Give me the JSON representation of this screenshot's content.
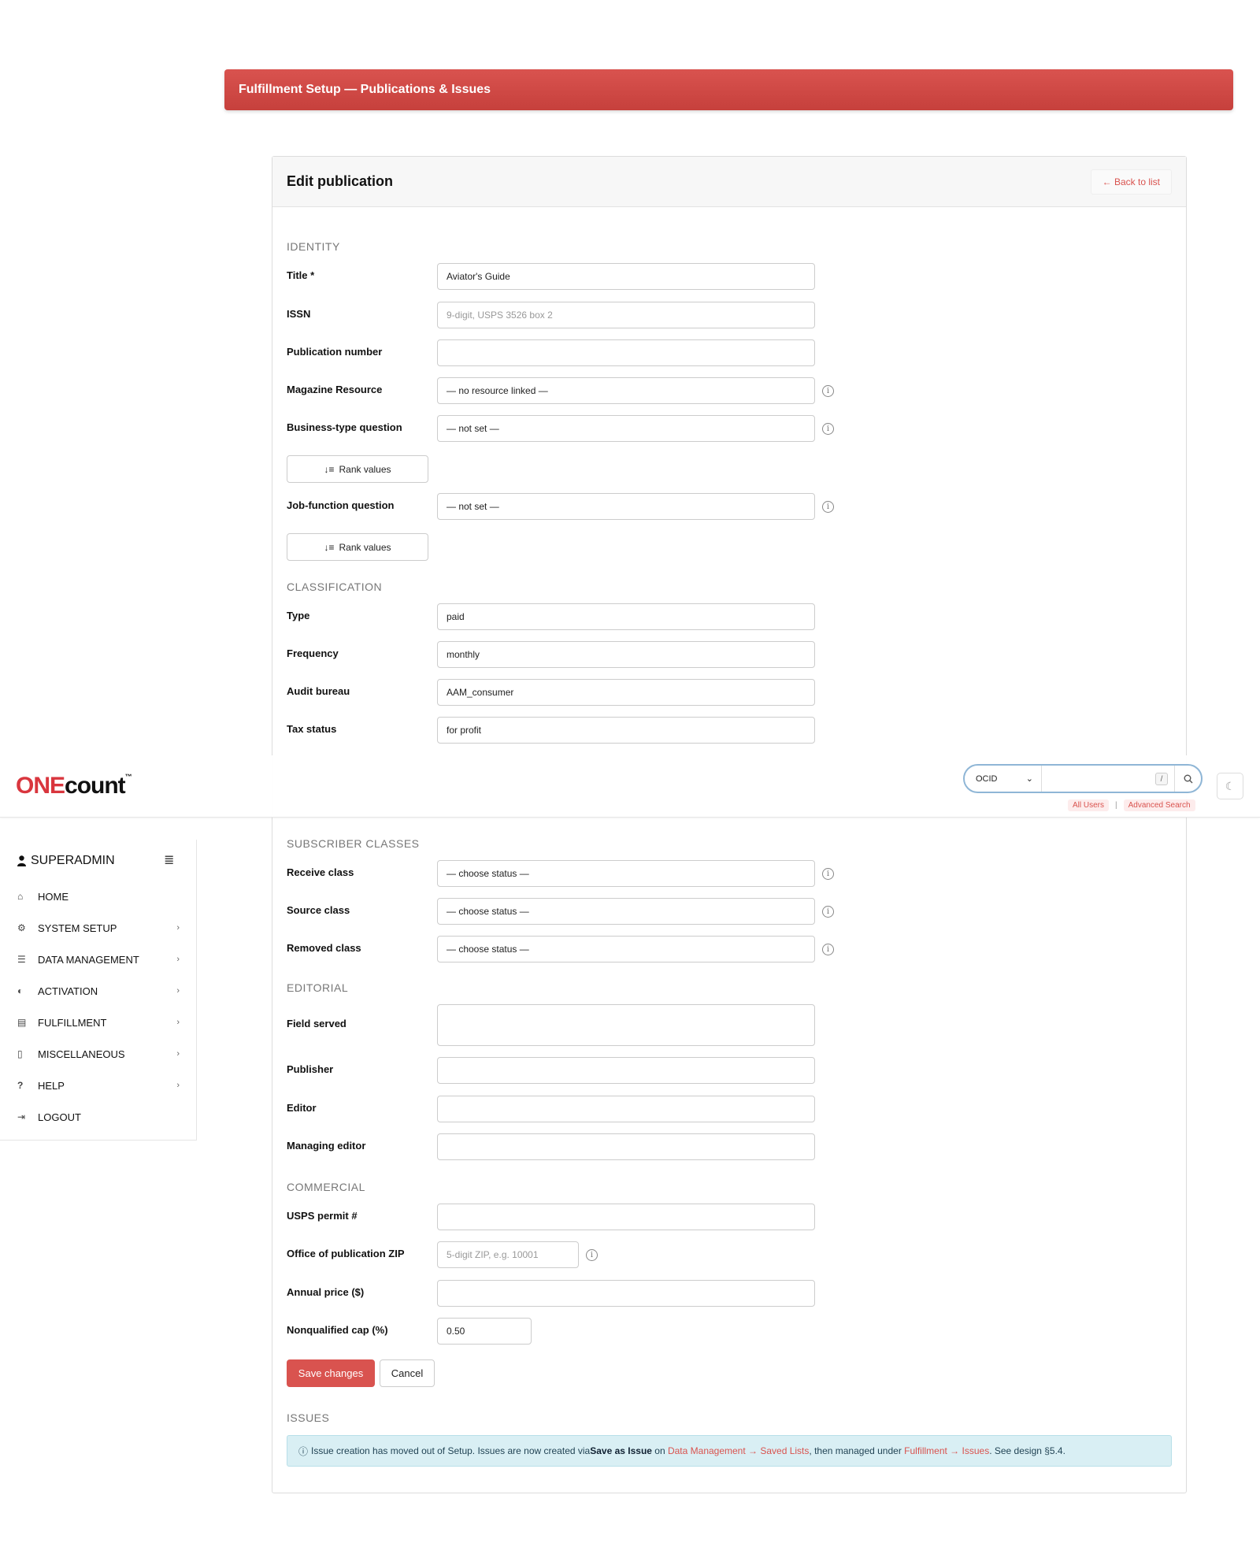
{
  "banner": {
    "title": "Fulfillment Setup — Publications & Issues"
  },
  "card": {
    "title": "Edit publication",
    "back_link": "← Back to list"
  },
  "sections": {
    "identity": "IDENTITY",
    "classification": "CLASSIFICATION",
    "subscriber_classes": "SUBSCRIBER CLASSES",
    "editorial": "EDITORIAL",
    "commercial": "COMMERCIAL",
    "issues": "ISSUES"
  },
  "identity": {
    "title_label": "Title *",
    "title_value": "Aviator's Guide",
    "issn_label": "ISSN",
    "issn_placeholder": "9-digit, USPS 3526 box 2",
    "pubnum_label": "Publication number",
    "pubnum_value": "",
    "magazine_label": "Magazine Resource",
    "magazine_value": "— no resource linked —",
    "business_label": "Business-type question",
    "business_value": "— not set —",
    "rank_label": "Rank values",
    "job_label": "Job-function question",
    "job_value": "— not set —"
  },
  "classification": {
    "type_label": "Type",
    "type_value": "paid",
    "frequency_label": "Frequency",
    "frequency_value": "monthly",
    "audit_label": "Audit bureau",
    "audit_value": "AAM_consumer",
    "tax_label": "Tax status",
    "tax_value": "for profit"
  },
  "subscriber_classes": {
    "receive_label": "Receive class",
    "receive_value": "— choose status —",
    "source_label": "Source class",
    "source_value": "— choose status —",
    "removed_label": "Removed class",
    "removed_value": "— choose status —"
  },
  "editorial": {
    "field_label": "Field served",
    "field_value": "",
    "publisher_label": "Publisher",
    "publisher_value": "",
    "editor_label": "Editor",
    "editor_value": "",
    "managing_label": "Managing editor",
    "managing_value": ""
  },
  "commercial": {
    "permit_label": "USPS permit #",
    "permit_value": "",
    "zip_label": "Office of publication ZIP",
    "zip_placeholder": "5-digit ZIP, e.g. 10001",
    "price_label": "Annual price ($)",
    "price_value": "",
    "cap_label": "Nonqualified cap (%)",
    "cap_value": "0.50"
  },
  "actions": {
    "save": "Save changes",
    "cancel": "Cancel"
  },
  "issues_alert": {
    "text1": "Issue creation has moved out of Setup. Issues are now created via ",
    "bold": "Save as Issue",
    "text2": " on ",
    "link1": "Data Management → Saved Lists",
    "text3": ", then managed under ",
    "link2": "Fulfillment → Issues",
    "text4": ". See design §5.4."
  },
  "header": {
    "logo_one": "ONE",
    "logo_count": "count",
    "logo_tm": "™",
    "search_select": "OCID",
    "search_slash": "/",
    "all_users": "All Users",
    "separator": "|",
    "advanced_search": "Advanced Search"
  },
  "sidebar": {
    "user": "SUPERADMIN",
    "items": [
      {
        "label": "HOME",
        "icon": "home-icon",
        "chevron": false
      },
      {
        "label": "SYSTEM SETUP",
        "icon": "gear-icon",
        "chevron": true
      },
      {
        "label": "DATA MANAGEMENT",
        "icon": "database-icon",
        "chevron": true
      },
      {
        "label": "ACTIVATION",
        "icon": "toggle-icon",
        "chevron": true
      },
      {
        "label": "FULFILLMENT",
        "icon": "newspaper-icon",
        "chevron": true
      },
      {
        "label": "MISCELLANEOUS",
        "icon": "file-icon",
        "chevron": true
      },
      {
        "label": "HELP",
        "icon": "question-icon",
        "chevron": true
      },
      {
        "label": "LOGOUT",
        "icon": "logout-icon",
        "chevron": false
      }
    ]
  }
}
